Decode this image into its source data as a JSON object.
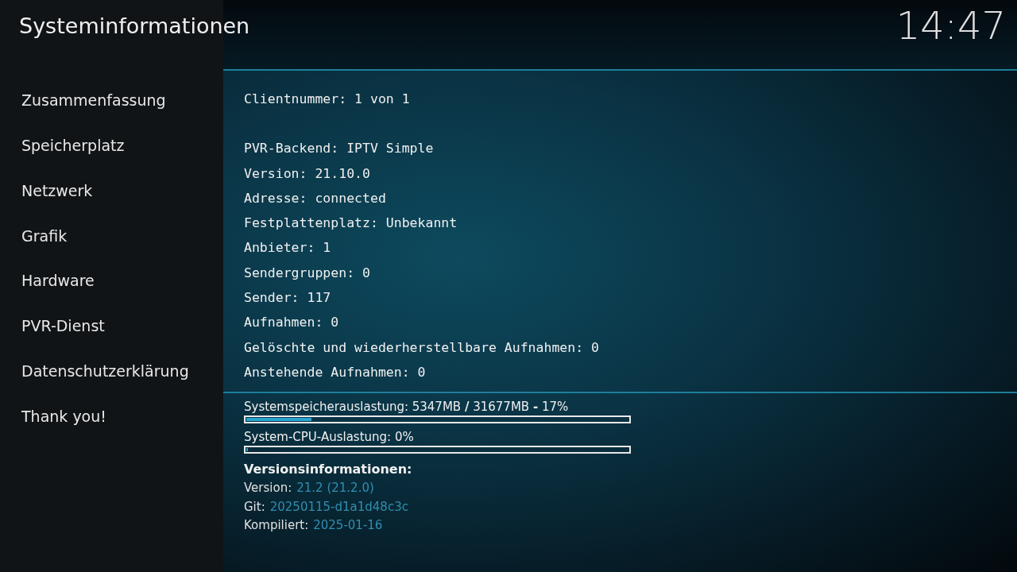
{
  "header": {
    "title": "Systeminformationen",
    "clock": "14:47"
  },
  "sidebar": {
    "items": [
      "Zusammenfassung",
      "Speicherplatz",
      "Netzwerk",
      "Grafik",
      "Hardware",
      "PVR-Dienst",
      "Datenschutzerklärung",
      "Thank you!"
    ]
  },
  "info_groups": [
    [
      "Clientnummer: 1 von 1"
    ],
    [
      "PVR-Backend: IPTV Simple",
      "Version: 21.10.0",
      "Adresse: connected",
      "Festplattenplatz: Unbekannt",
      "Anbieter: 1",
      "Sendergruppen: 0",
      "Sender: 117",
      "Aufnahmen: 0",
      "Gelöschte und wiederherstellbare Aufnahmen: 0",
      "Anstehende Aufnahmen: 0"
    ]
  ],
  "meters": [
    {
      "label": "Systemspeicherauslastung: 5347MB **/** 31677MB **-** 17%",
      "level": 0.17
    },
    {
      "label": "System-CPU-Auslastung: 0%",
      "level": 0
    }
  ],
  "version_info": {
    "heading": "Versionsinformationen:",
    "rows": [
      {
        "label": "Version:",
        "value": "21.2 (21.2.0)"
      },
      {
        "label": "Git:",
        "value": "20250115-d1a1d48c3c"
      },
      {
        "label": "Kompiliert:",
        "value": "2025-01-16"
      }
    ]
  }
}
